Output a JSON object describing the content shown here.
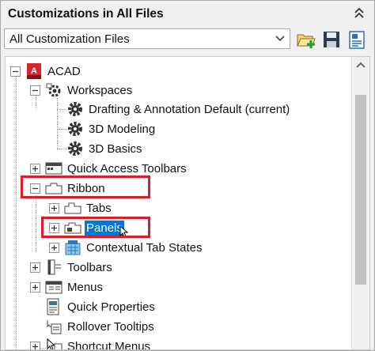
{
  "panel": {
    "title": "Customizations in All Files"
  },
  "toolbar": {
    "dropdown_value": "All Customization Files"
  },
  "tree": {
    "root": "ACAD",
    "workspaces": "Workspaces",
    "ws_items": [
      "Drafting & Annotation Default (current)",
      "3D Modeling",
      "3D Basics"
    ],
    "qat": "Quick Access Toolbars",
    "ribbon": "Ribbon",
    "tabs": "Tabs",
    "panels": "Panels",
    "ctx": "Contextual Tab States",
    "toolbars": "Toolbars",
    "menus": "Menus",
    "quickprops": "Quick Properties",
    "rollover": "Rollover Tooltips",
    "shortcut": "Shortcut Menus"
  },
  "colors": {
    "highlight": "#d81e2a",
    "selection": "#0078d7",
    "acad_logo": "#d9232e"
  }
}
